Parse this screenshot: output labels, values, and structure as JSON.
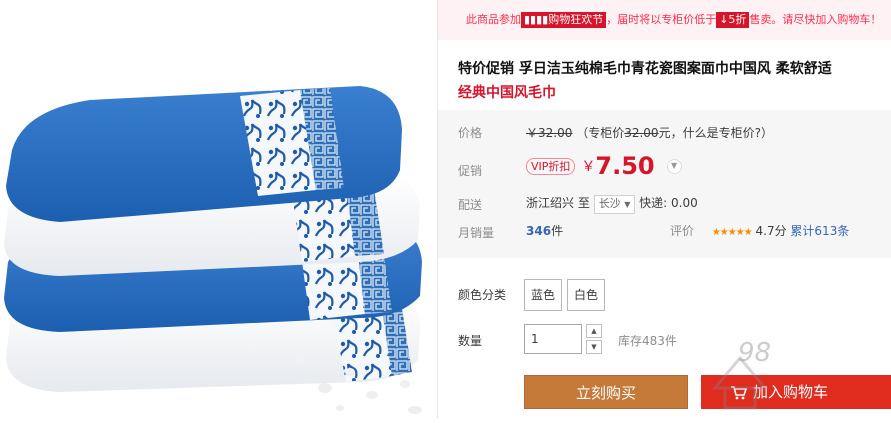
{
  "promo": {
    "prefix": "此商品参加",
    "event_tag": "▮▮▮▮购物狂欢节",
    "middle": "，届时将以专柜价低于",
    "discount": "↓5折",
    "suffix": "售卖。请尽快加入购物车！"
  },
  "product": {
    "title": "特价促销 孚日洁玉纯棉毛巾青花瓷图案面巾中国风 柔软舒适",
    "subtitle": "经典中国风毛巾"
  },
  "price": {
    "label": "价格",
    "original": "￥32.00",
    "counter_prefix": "（专柜价",
    "counter_value": "32.00",
    "counter_unit": "元，",
    "counter_link": "什么是专柜价?",
    "counter_suffix": "）"
  },
  "promo_price": {
    "label": "促销",
    "badge": "VIP折扣",
    "currency": "￥",
    "value": "7.50"
  },
  "shipping": {
    "label": "配送",
    "from": "浙江绍兴",
    "to_word": "至",
    "city": "长沙",
    "method": "快递: 0.00"
  },
  "sales": {
    "label": "月销量",
    "count": "346",
    "unit": "件",
    "review_label": "评价",
    "rating": 4.7,
    "stars": "★★★★★",
    "score_text": "4.7分",
    "review_count_text": "累计613条"
  },
  "sku": {
    "color_label": "颜色分类",
    "options": [
      "蓝色",
      "白色"
    ],
    "qty_label": "数量",
    "qty_value": "1",
    "stock_text": "库存483件"
  },
  "actions": {
    "buy_now": "立刻购买",
    "add_to_cart": "加入购物车"
  },
  "watermark_text": "98"
}
